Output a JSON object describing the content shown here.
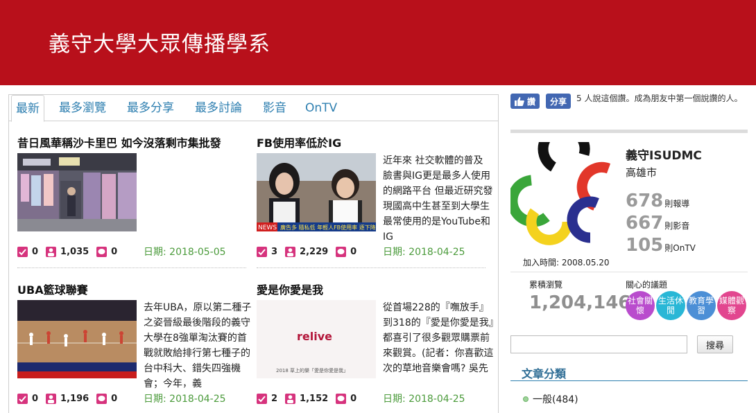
{
  "header": {
    "title": "義守大學大眾傳播學系"
  },
  "tabs": [
    "最新",
    "最多瀏覽",
    "最多分享",
    "最多討論",
    "影音",
    "OnTV"
  ],
  "articles": [
    {
      "title": "昔日風華稱沙卡里巴 如今沒落剩市集批發",
      "text": "",
      "likes": "0",
      "views": "1,035",
      "comments": "0",
      "date": "日期: 2018-05-05"
    },
    {
      "title": "FB使用率低於IG",
      "text": "近年來 社交軟體的普及 臉書與IG更是最多人使用的網路平台 但最近研究發現國高中生甚至到大學生 最常使用的是YouTube和IG",
      "likes": "3",
      "views": "2,229",
      "comments": "0",
      "date": "日期: 2018-04-25",
      "thumb_caption": "NEWS",
      "thumb_ticker": "廣告多 隨私低 年輕人FB使用率 逐下降"
    },
    {
      "title": "UBA籃球聯賽",
      "text": "去年UBA，原以第二種子之姿晉級最後階段的義守大學在8強單淘汰賽的首戰就敗給排行第七種子的台中科大、錯失四強機會；今年，義",
      "likes": "0",
      "views": "1,196",
      "comments": "0",
      "date": "日期: 2018-04-25"
    },
    {
      "title": "愛是你愛是我",
      "text": "從首場228的『嘸放手』到318的『愛是你愛是我』都喜引了很多觀眾購票前來觀賞。(記者：你喜歡這次的草地音樂會嗎? 吳先",
      "likes": "2",
      "views": "1,152",
      "comments": "0",
      "date": "日期: 2018-04-25",
      "thumb_word": "relive",
      "thumb_sub": "2018 草上的樂「愛是你愛是我」"
    }
  ],
  "sidebar": {
    "fb_like": "讚",
    "fb_share": "分享",
    "fb_text": "5 人說這個讚。成為朋友中第一個說讚的人。",
    "org_name": "義守ISUDMC",
    "org_city": "高雄市",
    "stats": [
      {
        "n": "678",
        "unit": "則報導"
      },
      {
        "n": "667",
        "unit": "則影音"
      },
      {
        "n": "105",
        "unit": "則OnTV"
      }
    ],
    "joined": "加入時間: 2008.05.20",
    "views_label": "累積瀏覽",
    "views_num": "1,204,146",
    "topics_label": "關心的議題",
    "topics": [
      {
        "label": "社會關懷",
        "color": "#b94ccd"
      },
      {
        "label": "生活休閒",
        "color": "#29b7d6"
      },
      {
        "label": "教育學習",
        "color": "#4c8fd6"
      },
      {
        "label": "媒體觀察",
        "color": "#e2468f"
      }
    ],
    "search_button": "搜尋",
    "category_title": "文章分類",
    "category_item": "一般(484)"
  },
  "colors": {
    "brand_red": "#b8101b",
    "link_blue": "#2e7fb0",
    "date_green": "#4a9a3a",
    "stat_pink": "#d6337d"
  }
}
